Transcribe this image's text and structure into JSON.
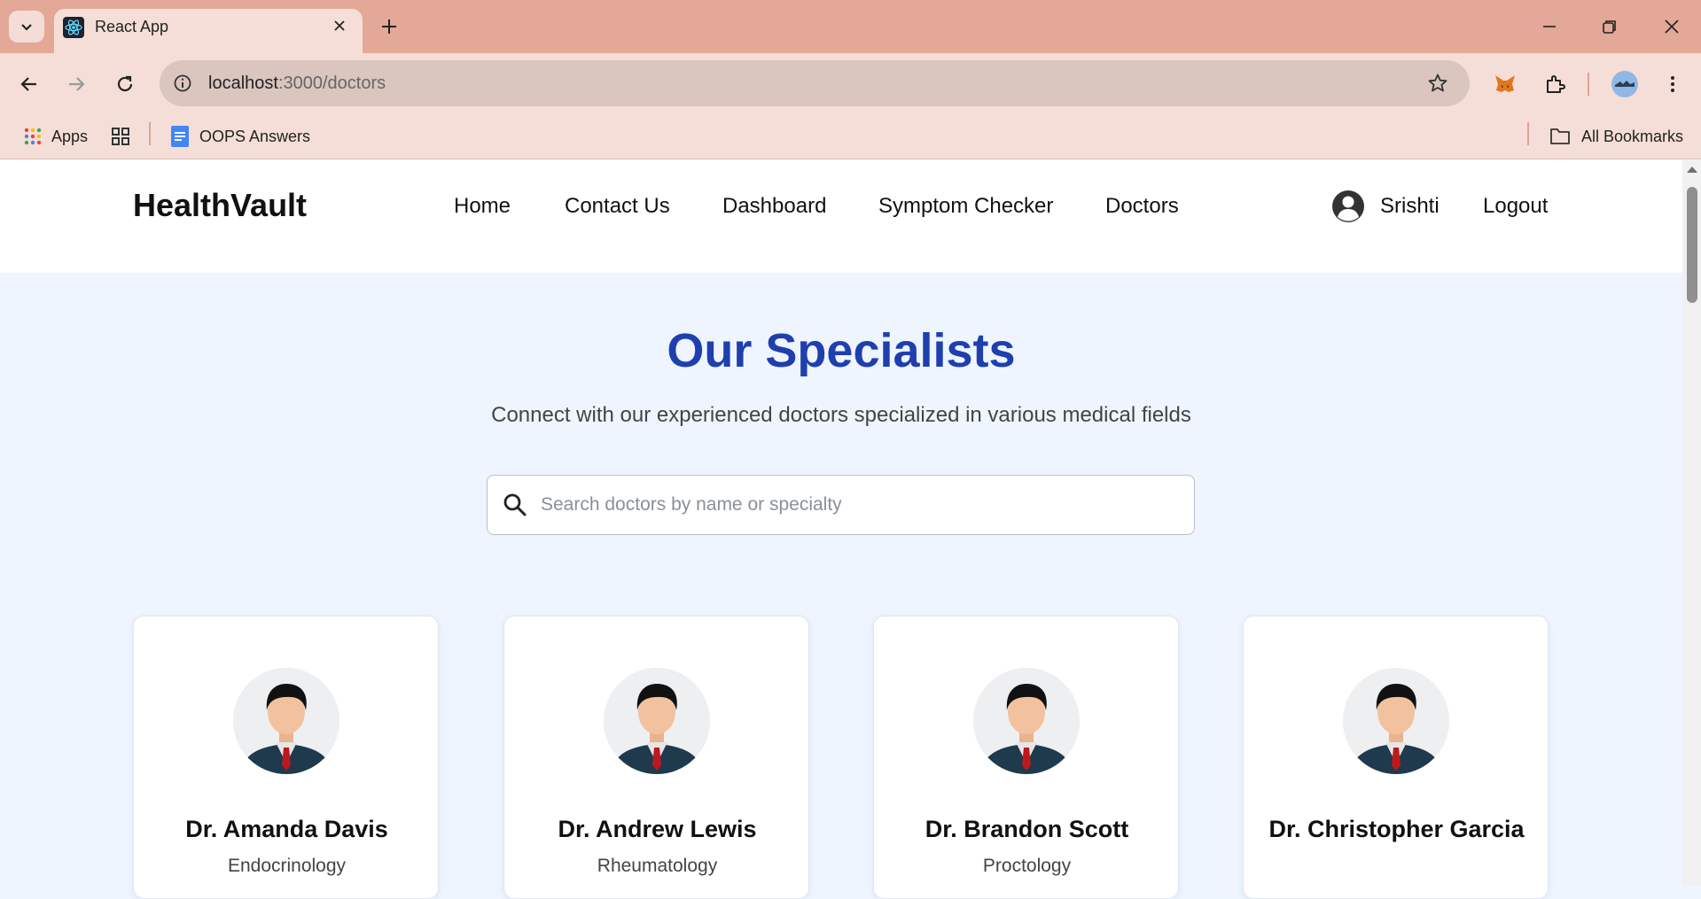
{
  "browser": {
    "tab_title": "React App",
    "url_host": "localhost",
    "url_path": ":3000/doctors",
    "bookmarks": {
      "apps_label": "Apps",
      "oops_label": "OOPS Answers",
      "all_bookmarks_label": "All Bookmarks"
    },
    "icons": [
      "react-icon",
      "close-icon",
      "plus-icon",
      "back-icon",
      "forward-icon",
      "reload-icon",
      "info-icon",
      "star-icon",
      "extensions-icon",
      "menu-icon"
    ]
  },
  "navbar": {
    "brand": "HealthVault",
    "links": [
      "Home",
      "Contact Us",
      "Dashboard",
      "Symptom Checker",
      "Doctors"
    ],
    "user_name": "Srishti",
    "logout_label": "Logout"
  },
  "main": {
    "title": "Our Specialists",
    "subtitle": "Connect with our experienced doctors specialized in various medical fields",
    "search_placeholder": "Search doctors by name or specialty",
    "search_value": ""
  },
  "doctors": [
    {
      "name": "Dr. Amanda Davis",
      "specialty": "Endocrinology"
    },
    {
      "name": "Dr. Andrew Lewis",
      "specialty": "Rheumatology"
    },
    {
      "name": "Dr. Brandon Scott",
      "specialty": "Proctology"
    },
    {
      "name": "Dr. Christopher Garcia",
      "specialty": ""
    }
  ],
  "colors": {
    "tabbar": "#e3a897",
    "toolbar": "#f5ded7",
    "page_bg": "#eef5fe",
    "title": "#1f3fae"
  }
}
